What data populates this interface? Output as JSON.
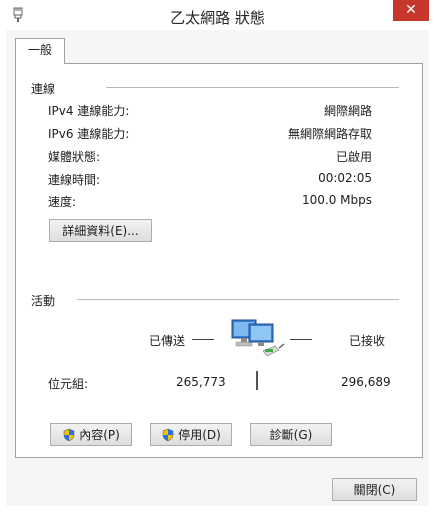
{
  "window": {
    "title": "乙太網路 狀態",
    "close_glyph": "✕"
  },
  "tabs": [
    {
      "label": "一般",
      "selected": true
    }
  ],
  "connection": {
    "header": "連線",
    "rows": [
      {
        "label": "IPv4 連線能力:",
        "value": "網際網路"
      },
      {
        "label": "IPv6 連線能力:",
        "value": "無網際網路存取"
      },
      {
        "label": "媒體狀態:",
        "value": "已啟用"
      },
      {
        "label": "連線時間:",
        "value": "00:02:05"
      },
      {
        "label": "速度:",
        "value": "100.0 Mbps"
      }
    ],
    "details_button": "詳細資料(E)..."
  },
  "activity": {
    "header": "活動",
    "sent_label": "已傳送",
    "received_label": "已接收",
    "bytes_label": "位元組:",
    "bytes_sent": "265,773",
    "bytes_received": "296,689"
  },
  "buttons": {
    "properties": "內容(P)",
    "disable": "停用(D)",
    "diagnose": "診斷(G)",
    "close": "關閉(C)"
  },
  "icons": {
    "title": "network-adapter-icon",
    "activity": "network-computers-icon",
    "shield": "uac-shield-icon"
  },
  "colors": {
    "close_button": "#c7372c",
    "window_background": "#f6f6f6",
    "panel_background": "#ffffff"
  }
}
